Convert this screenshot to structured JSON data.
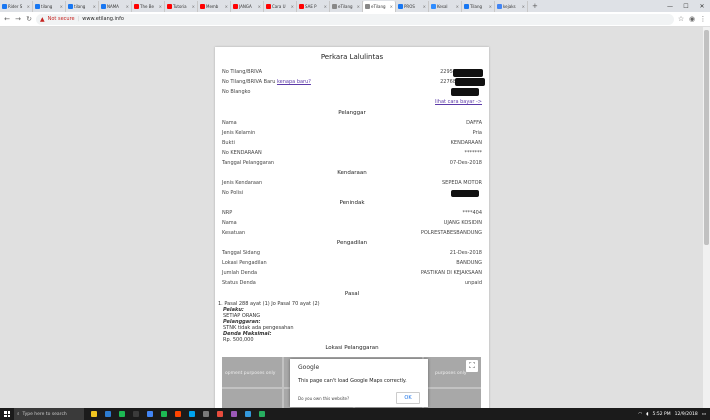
{
  "browser": {
    "tabs": [
      {
        "label": "Rider S",
        "color": "#1877f2"
      },
      {
        "label": "tilang",
        "color": "#1877f2"
      },
      {
        "label": "tilang",
        "color": "#1877f2"
      },
      {
        "label": "NAMA",
        "color": "#1877f2"
      },
      {
        "label": "The Be",
        "color": "#ff0000"
      },
      {
        "label": "Tutoria",
        "color": "#ff0000"
      },
      {
        "label": "Memb",
        "color": "#ff0000"
      },
      {
        "label": "JANGA",
        "color": "#ff0000"
      },
      {
        "label": "Cara U",
        "color": "#ff0000"
      },
      {
        "label": "SAE P",
        "color": "#ff0000"
      },
      {
        "label": "eTilang",
        "color": "#888888"
      },
      {
        "label": "eTilang",
        "color": "#888888"
      },
      {
        "label": "PROS",
        "color": "#1877f2"
      },
      {
        "label": "Kesal",
        "color": "#2d8cff"
      },
      {
        "label": "Tilang",
        "color": "#1877f2"
      },
      {
        "label": "kejaks",
        "color": "#4285f4"
      }
    ],
    "active_tab_index": 11,
    "new_tab": "+",
    "window_controls": {
      "minimize": "—",
      "maximize": "☐",
      "close": "✕"
    },
    "nav": {
      "back": "←",
      "forward": "→",
      "reload": "↻"
    },
    "security": "Not secure",
    "url": "www.etilang.info"
  },
  "page": {
    "title": "Perkara Lalulintas",
    "header_rows": [
      {
        "label": "No Tilang/BRIVA",
        "value": "22955"
      },
      {
        "label": "No Tilang/BRIVA Baru",
        "link": "kenapa baru?",
        "value": "22768"
      },
      {
        "label": "No Blangko",
        "value": "E"
      }
    ],
    "how_to_pay": "lihat cara bayar ->",
    "sections": {
      "pelanggar": "Pelanggar",
      "kendaraan": "Kendaraan",
      "penindak": "Penindak",
      "pengadilan": "Pengadilan",
      "pasal": "Pasal",
      "lokasi": "Lokasi Pelanggaran"
    },
    "pelanggar": [
      {
        "label": "Nama",
        "value": "DAFFA"
      },
      {
        "label": "Jenis Kelamin",
        "value": "Pria"
      },
      {
        "label": "Bukti",
        "value": "KENDARAAN"
      },
      {
        "label": "No KENDARAAN",
        "value": "*******"
      },
      {
        "label": "Tanggal Pelanggaran",
        "value": "07-Des-2018"
      }
    ],
    "kendaraan": [
      {
        "label": "Jenis Kendaraan",
        "value": "SEPEDA MOTOR"
      },
      {
        "label": "No Polisi",
        "value": ""
      }
    ],
    "penindak": [
      {
        "label": "NRP",
        "value": "****404"
      },
      {
        "label": "Nama",
        "value": "UJANG KOSIDIN"
      },
      {
        "label": "Kesatuan",
        "value": "POLRESTABESBANDUNG"
      }
    ],
    "pengadilan": [
      {
        "label": "Tanggal Sidang",
        "value": "21-Des-2018"
      },
      {
        "label": "Lokasi Pengadilan",
        "value": "BANDUNG"
      },
      {
        "label": "Jumlah Denda",
        "value": "PASTIKAN DI KEJAKSAAN"
      },
      {
        "label": "Status Denda",
        "value": "unpaid"
      }
    ],
    "pasal": {
      "item": "1. Pasal 288 ayat (1) Jo Pasal 70 ayat (2)",
      "pelaku_label": "Pelaku:",
      "pelaku": "SETIAP ORANG",
      "pelanggaran_label": "Pelanggaran:",
      "pelanggaran": "STNK tidak ada pengesahan",
      "denda_label": "Denda Maksimal:",
      "denda": "Rp. 500,000"
    },
    "map": {
      "dev_text_left": "opment purposes only",
      "dev_text_right": "purposes only",
      "fullscreen_icon": "⛶",
      "dialog_brand": "Google",
      "dialog_message": "This page can't load Google Maps correctly.",
      "dialog_own": "Do you own this website?",
      "dialog_ok": "OK"
    }
  },
  "taskbar": {
    "search_placeholder": "Type here to search",
    "time": "5:52 PM",
    "date": "12/9/2018",
    "icons": [
      "#f0c420",
      "#2d7dd2",
      "#1db954",
      "#3a3a3a",
      "#4285f4",
      "#1db954",
      "#ff4500",
      "#00a4ef",
      "#7a7a7a",
      "#e84c3d",
      "#9b59b6",
      "#3498db",
      "#27ae60"
    ]
  }
}
